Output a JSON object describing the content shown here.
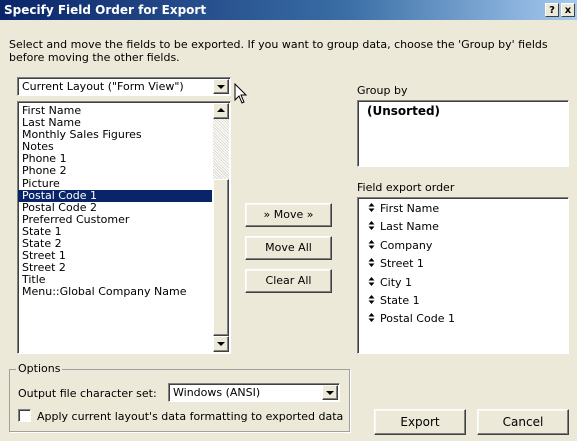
{
  "window": {
    "title": "Specify Field Order for Export",
    "help_label": "?",
    "close_label": "x"
  },
  "instructions": "Select and move the fields to be exported.  If you want to group data, choose the 'Group by' fields before moving the other fields.",
  "layout_select": {
    "value": "Current Layout (\"Form View\")"
  },
  "available_fields": {
    "items": [
      "First Name",
      "Last Name",
      "Monthly Sales Figures",
      "Notes",
      "Phone 1",
      "Phone 2",
      "Picture",
      "Postal Code 1",
      "Postal Code 2",
      "Preferred Customer",
      "State 1",
      "State 2",
      "Street 1",
      "Street 2",
      "Title",
      "Menu::Global Company Name"
    ],
    "selected_index": 7
  },
  "buttons": {
    "move": "» Move »",
    "move_all": "Move All",
    "clear_all": "Clear All",
    "export": "Export",
    "cancel": "Cancel"
  },
  "group_by": {
    "label": "Group by",
    "items": [
      "(Unsorted)"
    ]
  },
  "export_order": {
    "label": "Field export order",
    "items": [
      "First Name",
      "Last Name",
      "Company",
      "Street 1",
      "City 1",
      "State 1",
      "Postal Code 1"
    ]
  },
  "options": {
    "legend": "Options",
    "charset_label": "Output file character set:",
    "charset_value": "Windows (ANSI)",
    "apply_formatting_label": "Apply current layout's data formatting to exported data",
    "apply_formatting_checked": false
  },
  "icons": {
    "cursor": "mouse-pointer-icon",
    "grip": "drag-handle-icon"
  }
}
